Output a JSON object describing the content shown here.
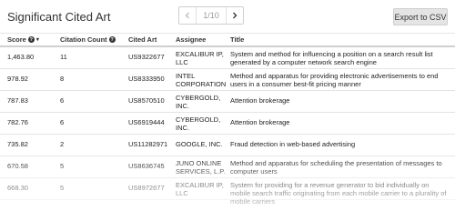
{
  "header": {
    "title": "Significant Cited Art",
    "pager": {
      "count": "1/10",
      "prev_icon": "chevron-left-icon",
      "next_icon": "chevron-right-icon"
    },
    "export_label": "Export to CSV"
  },
  "table": {
    "columns": {
      "score": "Score",
      "citation_count": "Citation Count",
      "cited_art": "Cited Art",
      "assignee": "Assignee",
      "title": "Title"
    },
    "rows": [
      {
        "score": "1,463.80",
        "count": "11",
        "art": "US9322677",
        "assignee": "EXCALIBUR IP, LLC",
        "title": "System and method for influencing a position on a search result list generated by a computer network search engine"
      },
      {
        "score": "978.92",
        "count": "8",
        "art": "US8333950",
        "assignee": "INTEL CORPORATION",
        "title": "Method and apparatus for providing electronic advertisements to end users in a consumer best-fit pricing manner"
      },
      {
        "score": "787.83",
        "count": "6",
        "art": "US8570510",
        "assignee": "CYBERGOLD, INC.",
        "title": "Attention brokerage"
      },
      {
        "score": "782.76",
        "count": "6",
        "art": "US6919444",
        "assignee": "CYBERGOLD, INC.",
        "title": "Attention brokerage"
      },
      {
        "score": "735.82",
        "count": "2",
        "art": "US11282971",
        "assignee": "GOOGLE, INC.",
        "title": "Fraud detection in web-based advertising"
      },
      {
        "score": "670.58",
        "count": "5",
        "art": "US8636745",
        "assignee": "JUNO ONLINE SERVICES, L.P.",
        "title": "Method and apparatus for scheduling the presentation of messages to computer users"
      },
      {
        "score": "668.30",
        "count": "5",
        "art": "US8972677",
        "assignee": "EXCALIBUR IP, LLC",
        "title": "System for providing for a revenue generator to bid individually on mobile search traffic originating from each mobile carrier to a plurality of mobile carriers"
      }
    ]
  }
}
